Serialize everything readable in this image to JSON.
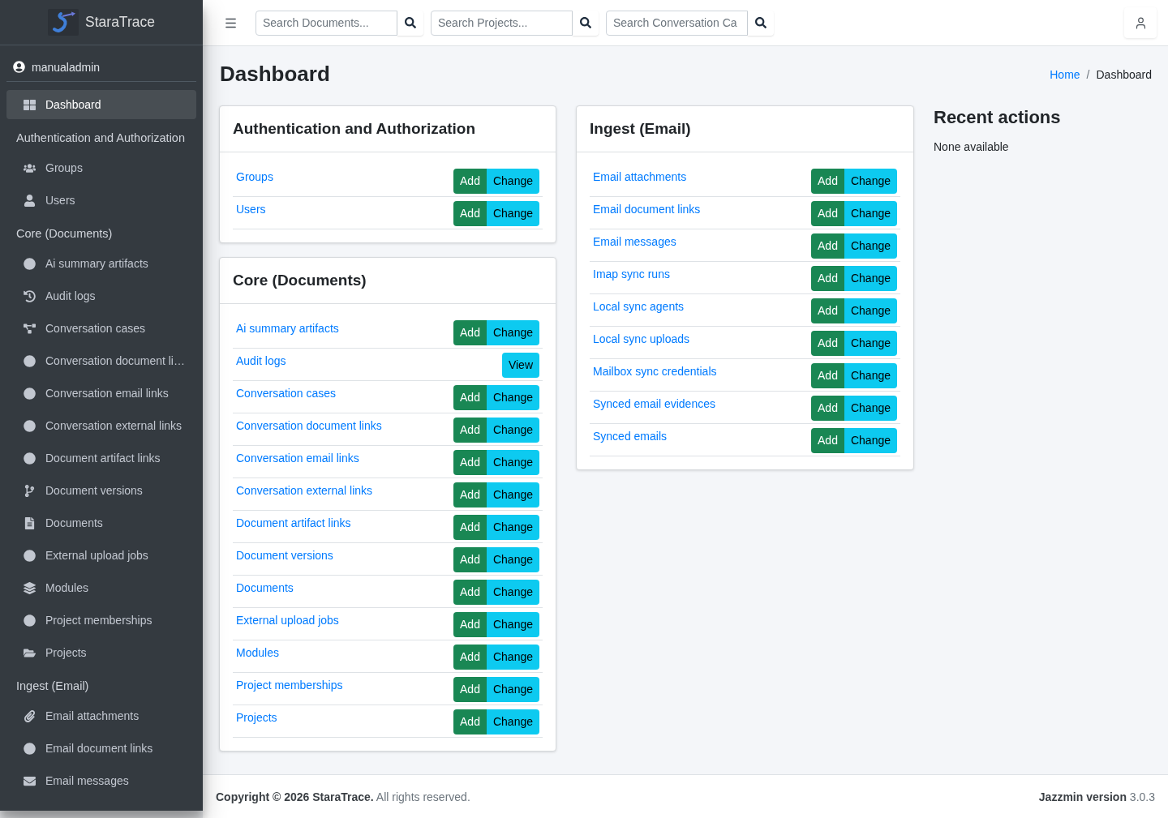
{
  "sidebar": {
    "brand": "StaraTrace",
    "user": "manualadmin",
    "items": [
      {
        "label": "Dashboard",
        "selected": true
      }
    ],
    "sections": [
      {
        "title": "Authentication and Authorization",
        "items": [
          {
            "label": "Groups",
            "selected": false
          },
          {
            "label": "Users",
            "selected": false
          }
        ]
      },
      {
        "title": "Core (Documents)",
        "items": [
          {
            "label": "Ai summary artifacts",
            "selected": false
          },
          {
            "label": "Audit logs",
            "selected": false
          },
          {
            "label": "Conversation cases",
            "selected": false
          },
          {
            "label": "Conversation document li…",
            "selected": false
          },
          {
            "label": "Conversation email links",
            "selected": false
          },
          {
            "label": "Conversation external links",
            "selected": false
          },
          {
            "label": "Document artifact links",
            "selected": false
          },
          {
            "label": "Document versions",
            "selected": false
          },
          {
            "label": "Documents",
            "selected": false
          },
          {
            "label": "External upload jobs",
            "selected": false
          },
          {
            "label": "Modules",
            "selected": false
          },
          {
            "label": "Project memberships",
            "selected": false
          },
          {
            "label": "Projects",
            "selected": false
          }
        ]
      },
      {
        "title": "Ingest (Email)",
        "items": [
          {
            "label": "Email attachments",
            "selected": false
          },
          {
            "label": "Email document links",
            "selected": false
          },
          {
            "label": "Email messages",
            "selected": false
          }
        ]
      }
    ]
  },
  "topbar": {
    "searches": [
      {
        "placeholder": "Search Documents..."
      },
      {
        "placeholder": "Search Projects..."
      },
      {
        "placeholder": "Search Conversation Ca"
      }
    ]
  },
  "page": {
    "title": "Dashboard",
    "breadcrumb": {
      "separator": "/",
      "items": [
        {
          "label": "Home",
          "kind": "link"
        },
        {
          "label": "Dashboard",
          "kind": "current"
        }
      ]
    }
  },
  "app_columns": [
    {
      "apps": [
        {
          "title": "Authentication and Authorization",
          "models": [
            {
              "name": "Groups",
              "actions": [
                {
                  "label": "Add",
                  "kind": "add"
                },
                {
                  "label": "Change",
                  "kind": "change"
                }
              ]
            },
            {
              "name": "Users",
              "actions": [
                {
                  "label": "Add",
                  "kind": "add"
                },
                {
                  "label": "Change",
                  "kind": "change"
                }
              ]
            }
          ]
        },
        {
          "title": "Core (Documents)",
          "models": [
            {
              "name": "Ai summary artifacts",
              "actions": [
                {
                  "label": "Add",
                  "kind": "add"
                },
                {
                  "label": "Change",
                  "kind": "change"
                }
              ]
            },
            {
              "name": "Audit logs",
              "actions": [
                {
                  "label": "View",
                  "kind": "view"
                }
              ]
            },
            {
              "name": "Conversation cases",
              "actions": [
                {
                  "label": "Add",
                  "kind": "add"
                },
                {
                  "label": "Change",
                  "kind": "change"
                }
              ]
            },
            {
              "name": "Conversation document links",
              "actions": [
                {
                  "label": "Add",
                  "kind": "add"
                },
                {
                  "label": "Change",
                  "kind": "change"
                }
              ]
            },
            {
              "name": "Conversation email links",
              "actions": [
                {
                  "label": "Add",
                  "kind": "add"
                },
                {
                  "label": "Change",
                  "kind": "change"
                }
              ]
            },
            {
              "name": "Conversation external links",
              "actions": [
                {
                  "label": "Add",
                  "kind": "add"
                },
                {
                  "label": "Change",
                  "kind": "change"
                }
              ]
            },
            {
              "name": "Document artifact links",
              "actions": [
                {
                  "label": "Add",
                  "kind": "add"
                },
                {
                  "label": "Change",
                  "kind": "change"
                }
              ]
            },
            {
              "name": "Document versions",
              "actions": [
                {
                  "label": "Add",
                  "kind": "add"
                },
                {
                  "label": "Change",
                  "kind": "change"
                }
              ]
            },
            {
              "name": "Documents",
              "actions": [
                {
                  "label": "Add",
                  "kind": "add"
                },
                {
                  "label": "Change",
                  "kind": "change"
                }
              ]
            },
            {
              "name": "External upload jobs",
              "actions": [
                {
                  "label": "Add",
                  "kind": "add"
                },
                {
                  "label": "Change",
                  "kind": "change"
                }
              ]
            },
            {
              "name": "Modules",
              "actions": [
                {
                  "label": "Add",
                  "kind": "add"
                },
                {
                  "label": "Change",
                  "kind": "change"
                }
              ]
            },
            {
              "name": "Project memberships",
              "actions": [
                {
                  "label": "Add",
                  "kind": "add"
                },
                {
                  "label": "Change",
                  "kind": "change"
                }
              ]
            },
            {
              "name": "Projects",
              "actions": [
                {
                  "label": "Add",
                  "kind": "add"
                },
                {
                  "label": "Change",
                  "kind": "change"
                }
              ]
            }
          ]
        }
      ]
    },
    {
      "apps": [
        {
          "title": "Ingest (Email)",
          "models": [
            {
              "name": "Email attachments",
              "actions": [
                {
                  "label": "Add",
                  "kind": "add"
                },
                {
                  "label": "Change",
                  "kind": "change"
                }
              ]
            },
            {
              "name": "Email document links",
              "actions": [
                {
                  "label": "Add",
                  "kind": "add"
                },
                {
                  "label": "Change",
                  "kind": "change"
                }
              ]
            },
            {
              "name": "Email messages",
              "actions": [
                {
                  "label": "Add",
                  "kind": "add"
                },
                {
                  "label": "Change",
                  "kind": "change"
                }
              ]
            },
            {
              "name": "Imap sync runs",
              "actions": [
                {
                  "label": "Add",
                  "kind": "add"
                },
                {
                  "label": "Change",
                  "kind": "change"
                }
              ]
            },
            {
              "name": "Local sync agents",
              "actions": [
                {
                  "label": "Add",
                  "kind": "add"
                },
                {
                  "label": "Change",
                  "kind": "change"
                }
              ]
            },
            {
              "name": "Local sync uploads",
              "actions": [
                {
                  "label": "Add",
                  "kind": "add"
                },
                {
                  "label": "Change",
                  "kind": "change"
                }
              ]
            },
            {
              "name": "Mailbox sync credentials",
              "actions": [
                {
                  "label": "Add",
                  "kind": "add"
                },
                {
                  "label": "Change",
                  "kind": "change"
                }
              ]
            },
            {
              "name": "Synced email evidences",
              "actions": [
                {
                  "label": "Add",
                  "kind": "add"
                },
                {
                  "label": "Change",
                  "kind": "change"
                }
              ]
            },
            {
              "name": "Synced emails",
              "actions": [
                {
                  "label": "Add",
                  "kind": "add"
                },
                {
                  "label": "Change",
                  "kind": "change"
                }
              ]
            }
          ]
        }
      ]
    }
  ],
  "recent_actions": {
    "title": "Recent actions",
    "text": "None available"
  },
  "footer": {
    "left": "**Copyright © 2026 StaraTrace.** All rights reserved.",
    "right": "**Jazzmin version** 3.0.3"
  }
}
